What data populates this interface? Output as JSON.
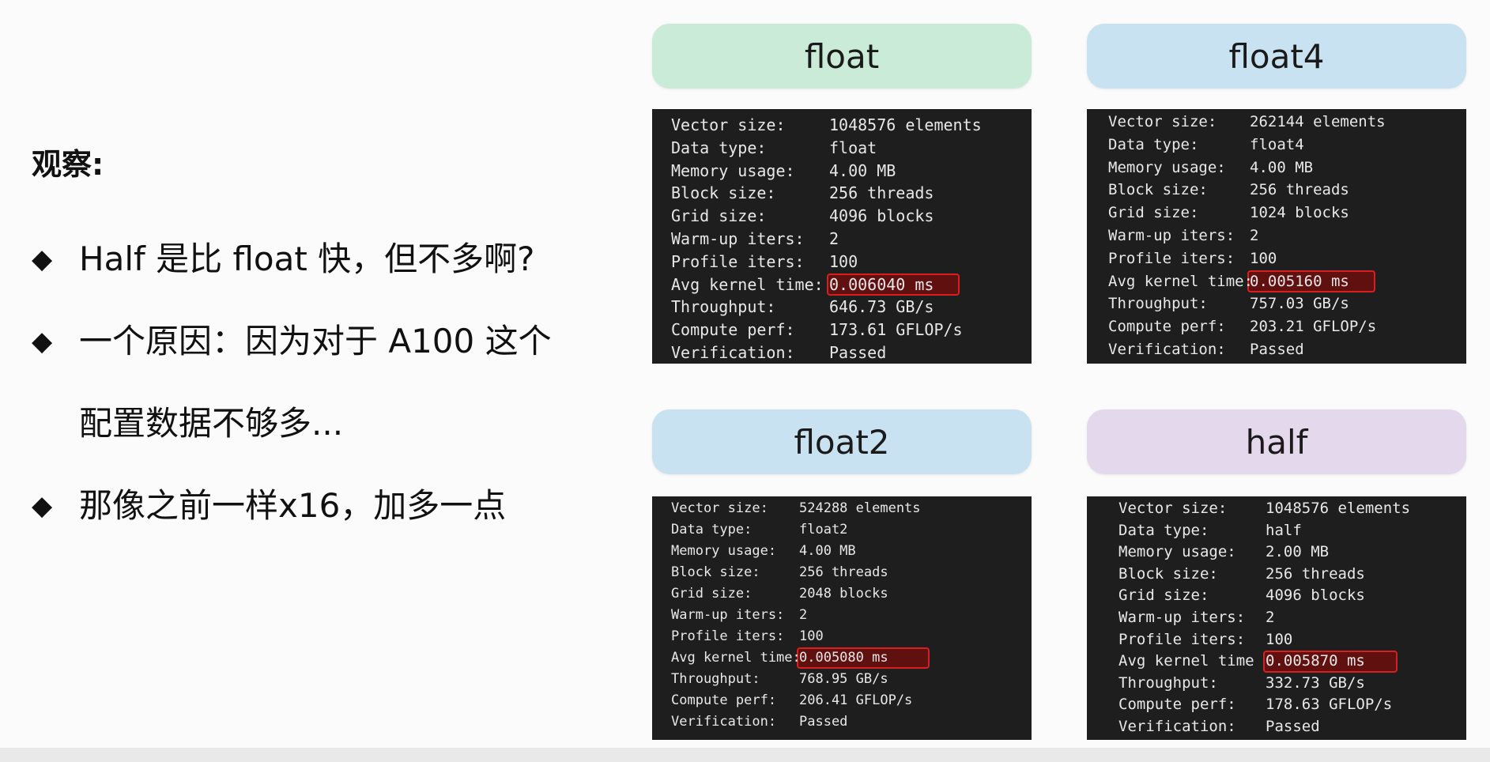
{
  "left": {
    "heading": "观察:",
    "bullets": [
      {
        "diamond": "◆",
        "text": "Half 是比 float 快，但不多啊?"
      },
      {
        "diamond": "◆",
        "text": "一个原因：因为对于 A100 这个"
      },
      {
        "diamond": "",
        "text": "配置数据不够多..."
      },
      {
        "diamond": "◆",
        "text": "那像之前一样x16，加多一点"
      }
    ]
  },
  "panels": {
    "float": {
      "title": "float",
      "rows": [
        [
          "Vector size:",
          "1048576 elements"
        ],
        [
          "Data type:",
          "float"
        ],
        [
          "Memory usage:",
          "4.00 MB"
        ],
        [
          "Block size:",
          "256 threads"
        ],
        [
          "Grid size:",
          "4096 blocks"
        ],
        [
          "Warm-up iters:",
          "2"
        ],
        [
          "Profile iters:",
          "100"
        ],
        [
          "Avg kernel time:",
          "0.006040 ms"
        ],
        [
          "Throughput:",
          "646.73 GB/s"
        ],
        [
          "Compute perf:",
          "173.61 GFLOP/s"
        ],
        [
          "Verification:",
          "Passed"
        ]
      ]
    },
    "float4": {
      "title": "float4",
      "rows": [
        [
          "Vector size:",
          "262144 elements"
        ],
        [
          "Data type:",
          "float4"
        ],
        [
          "Memory usage:",
          "4.00 MB"
        ],
        [
          "Block size:",
          "256 threads"
        ],
        [
          "Grid size:",
          "1024 blocks"
        ],
        [
          "Warm-up iters:",
          "2"
        ],
        [
          "Profile iters:",
          "100"
        ],
        [
          "Avg kernel time:",
          "0.005160 ms"
        ],
        [
          "Throughput:",
          "757.03 GB/s"
        ],
        [
          "Compute perf:",
          "203.21 GFLOP/s"
        ],
        [
          "Verification:",
          "Passed"
        ]
      ]
    },
    "float2": {
      "title": "float2",
      "rows": [
        [
          "Vector size:",
          "524288 elements"
        ],
        [
          "Data type:",
          "float2"
        ],
        [
          "Memory usage:",
          "4.00 MB"
        ],
        [
          "Block size:",
          "256 threads"
        ],
        [
          "Grid size:",
          "2048 blocks"
        ],
        [
          "Warm-up iters:",
          "2"
        ],
        [
          "Profile iters:",
          "100"
        ],
        [
          "Avg kernel time:",
          "0.005080 ms"
        ],
        [
          "Throughput:",
          "768.95 GB/s"
        ],
        [
          "Compute perf:",
          "206.41 GFLOP/s"
        ],
        [
          "Verification:",
          "Passed"
        ]
      ]
    },
    "half": {
      "title": "half",
      "rows": [
        [
          "Vector size:",
          "1048576 elements"
        ],
        [
          "Data type:",
          "half"
        ],
        [
          "Memory usage:",
          "2.00 MB"
        ],
        [
          "Block size:",
          "256 threads"
        ],
        [
          "Grid size:",
          "4096 blocks"
        ],
        [
          "Warm-up iters:",
          "2"
        ],
        [
          "Profile iters:",
          "100"
        ],
        [
          "Avg kernel time",
          "0.005870 ms"
        ],
        [
          "Throughput:",
          "332.73 GB/s"
        ],
        [
          "Compute perf:",
          "178.63 GFLOP/s"
        ],
        [
          "Verification:",
          "Passed"
        ]
      ]
    }
  },
  "colors": {
    "float_pill": "#c9ebd7",
    "float4_pill": "#c9e2f1",
    "float2_pill": "#c9e2f1",
    "half_pill": "#e4d8ec",
    "terminal_bg": "#1e1e1e",
    "highlight_border": "#d42020"
  }
}
